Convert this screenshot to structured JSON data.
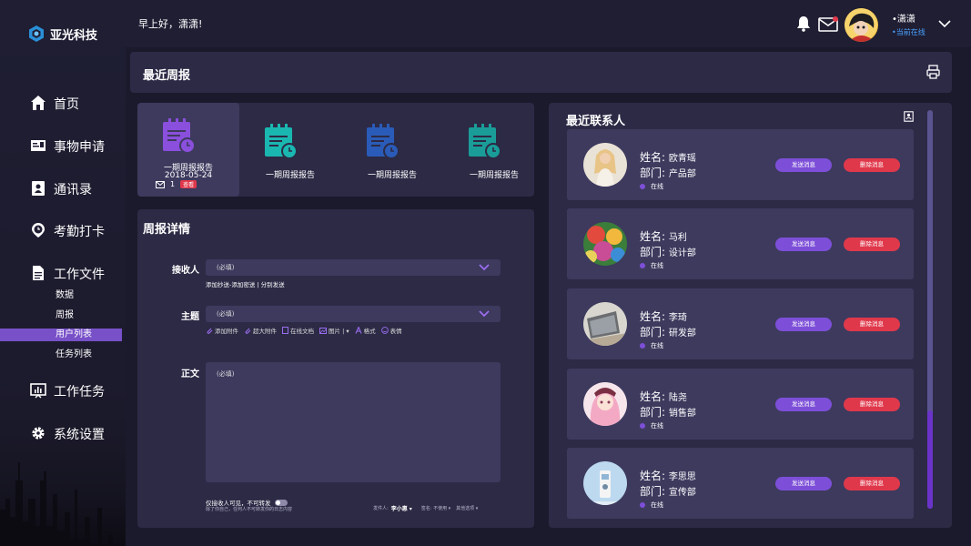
{
  "app": {
    "name": "亚光科技"
  },
  "header": {
    "greeting": "早上好，潇潇!",
    "user_name": "•潇潇",
    "user_status": "•当前在线"
  },
  "nav": [
    {
      "label": "首页",
      "icon": "home-icon"
    },
    {
      "label": "事物申请",
      "icon": "id-card-icon"
    },
    {
      "label": "通讯录",
      "icon": "contacts-icon"
    },
    {
      "label": "考勤打卡",
      "icon": "clock-pin-icon"
    },
    {
      "label": "工作文件",
      "icon": "document-icon"
    },
    {
      "label": "工作任务",
      "icon": "chart-board-icon"
    },
    {
      "label": "系统设置",
      "icon": "gear-icon"
    }
  ],
  "subnav": [
    "数据",
    "周报",
    "用户列表",
    "任务列表"
  ],
  "recent": {
    "title": "最近周报",
    "reports": [
      {
        "label": "一期周报报告",
        "date": "2018-05-24",
        "count": "1",
        "badge": "查看",
        "color": "#8a4fdc"
      },
      {
        "label": "一期周报报告",
        "color": "#1ab7b1"
      },
      {
        "label": "一期周报报告",
        "color": "#2a5bb8"
      },
      {
        "label": "一期周报报告",
        "color": "#1a9d98"
      }
    ]
  },
  "details": {
    "title": "周报详情",
    "recipient_label": "接收人",
    "recipient_placeholder": "(必填)",
    "recipient_hint": "添加抄送-添加密送 | 分别发送",
    "subject_label": "主题",
    "subject_placeholder": "(必填)",
    "tools": [
      "添加附件",
      "超大附件",
      "在线文档",
      "图片 | ▾",
      "格式",
      "表情"
    ],
    "body_label": "正文",
    "body_placeholder": "(必填)",
    "footer_note1": "仅接收人可见，不可转发",
    "footer_note2": "除了你自己，任何人不可转发你的日志内容",
    "sender_label": "发件人:",
    "sender_name": "李小惠 ▾",
    "sign_label": "签名: 不使用 ▾",
    "other_label": "其他选项 ▾"
  },
  "contacts": {
    "title": "最近联系人",
    "name_label": "姓名:",
    "dept_label": "部门:",
    "send_label": "发送消息",
    "delete_label": "删除消息",
    "items": [
      {
        "name": "欧青瑶",
        "dept": "产品部",
        "status": "在线"
      },
      {
        "name": "马利",
        "dept": "设计部",
        "status": "在线"
      },
      {
        "name": "李琦",
        "dept": "研发部",
        "status": "在线"
      },
      {
        "name": "陆尧",
        "dept": "销售部",
        "status": "在线"
      },
      {
        "name": "李思思",
        "dept": "宣传部",
        "status": "在线"
      }
    ]
  }
}
